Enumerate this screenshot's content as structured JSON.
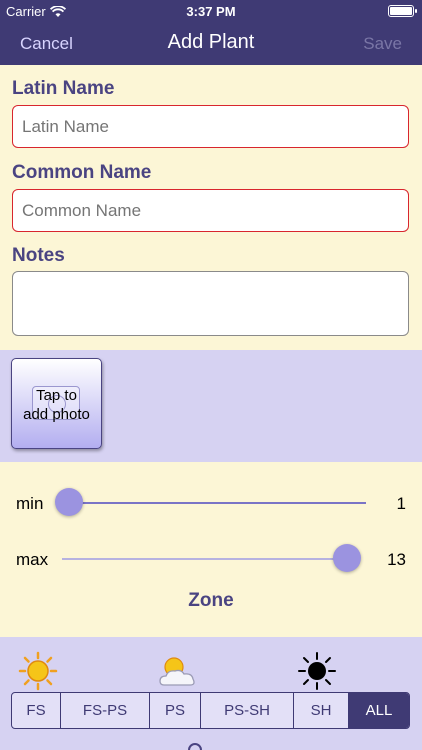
{
  "status": {
    "carrier": "Carrier",
    "time": "3:37 PM"
  },
  "nav": {
    "cancel": "Cancel",
    "title": "Add Plant",
    "save": "Save"
  },
  "form": {
    "latin_label": "Latin Name",
    "latin_placeholder": "Latin Name",
    "common_label": "Common Name",
    "common_placeholder": "Common Name",
    "notes_label": "Notes",
    "notes_value": ""
  },
  "photo": {
    "label": "Tap to\nadd photo"
  },
  "zone": {
    "min_label": "min",
    "min_value": "1",
    "max_label": "max",
    "max_value": "13",
    "title": "Zone"
  },
  "sun": {
    "segments": [
      "FS",
      "FS-PS",
      "PS",
      "PS-SH",
      "SH",
      "ALL"
    ],
    "selected": "ALL"
  },
  "colors": {
    "nav": "#3f3a74",
    "accent": "#4a4482",
    "cream": "#fcf6d6",
    "lavender": "#d6d2f2"
  }
}
